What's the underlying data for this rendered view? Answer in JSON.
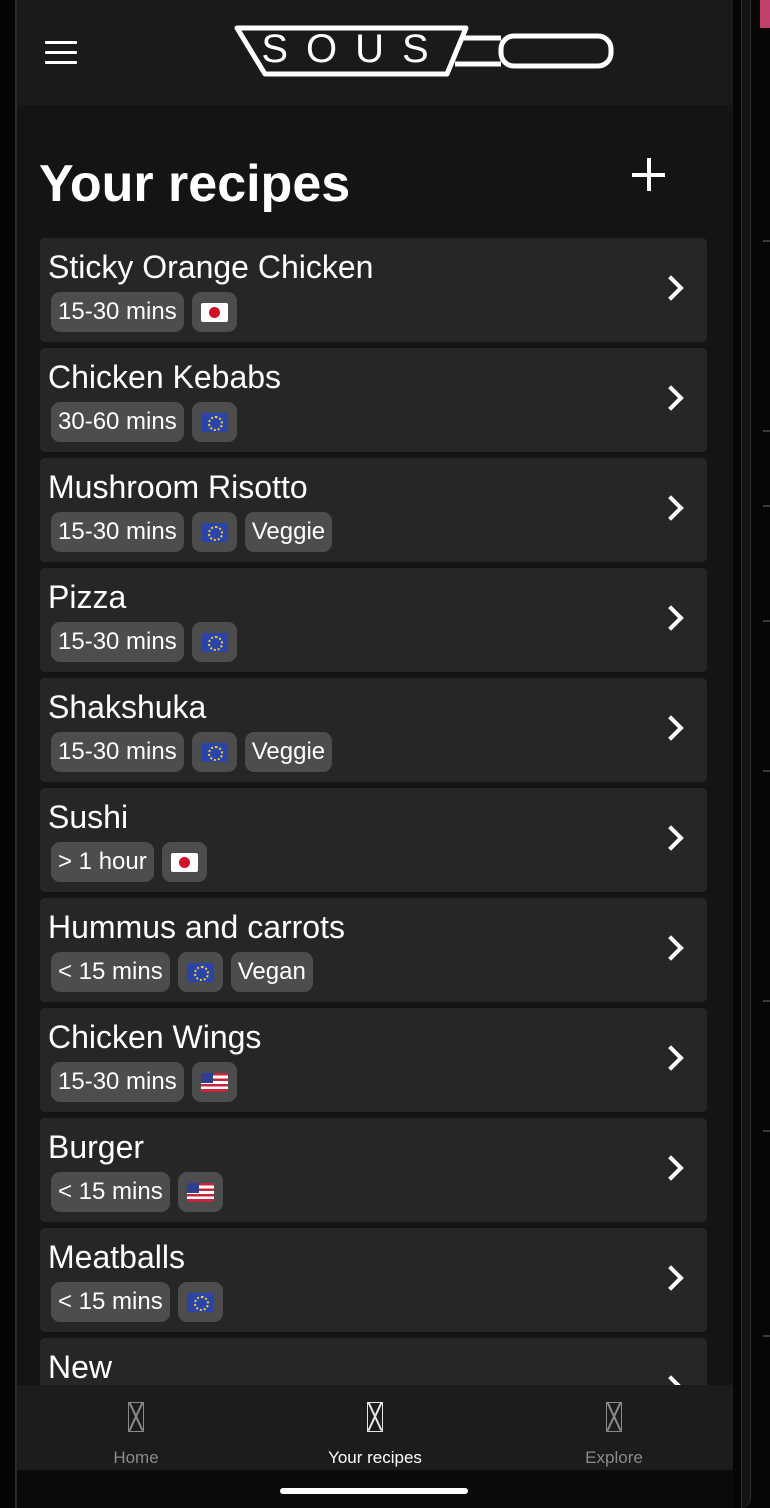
{
  "header": {
    "logo_text": "SOUS"
  },
  "page": {
    "title": "Your recipes"
  },
  "recipes": [
    {
      "name": "Sticky Orange Chicken",
      "time": "15-30 mins",
      "flag": "japan-flag",
      "diet": ""
    },
    {
      "name": "Chicken Kebabs",
      "time": "30-60 mins",
      "flag": "eu-flag",
      "diet": ""
    },
    {
      "name": "Mushroom Risotto",
      "time": "15-30 mins",
      "flag": "eu-flag",
      "diet": "Veggie"
    },
    {
      "name": "Pizza",
      "time": "15-30 mins",
      "flag": "eu-flag",
      "diet": ""
    },
    {
      "name": "Shakshuka",
      "time": "15-30 mins",
      "flag": "eu-flag",
      "diet": "Veggie"
    },
    {
      "name": "Sushi",
      "time": "> 1 hour",
      "flag": "japan-flag",
      "diet": ""
    },
    {
      "name": "Hummus and carrots",
      "time": "< 15 mins",
      "flag": "eu-flag",
      "diet": "Vegan"
    },
    {
      "name": "Chicken Wings",
      "time": "15-30 mins",
      "flag": "us-flag",
      "diet": ""
    },
    {
      "name": "Burger",
      "time": "< 15 mins",
      "flag": "us-flag",
      "diet": ""
    },
    {
      "name": "Meatballs",
      "time": "< 15 mins",
      "flag": "eu-flag",
      "diet": ""
    },
    {
      "name": "New",
      "time": "",
      "flag": "",
      "diet": ""
    }
  ],
  "bottom_nav": {
    "items": [
      {
        "label": "Home",
        "icon": "missing-glyph-icon",
        "active": false
      },
      {
        "label": "Your recipes",
        "icon": "missing-glyph-icon",
        "active": true
      },
      {
        "label": "Explore",
        "icon": "missing-glyph-icon",
        "active": false
      }
    ]
  },
  "colors": {
    "background": "#141414",
    "card": "#262626",
    "tag": "#4d4d4d",
    "text": "#ffffff",
    "nav_inactive": "#8a8a8a"
  }
}
